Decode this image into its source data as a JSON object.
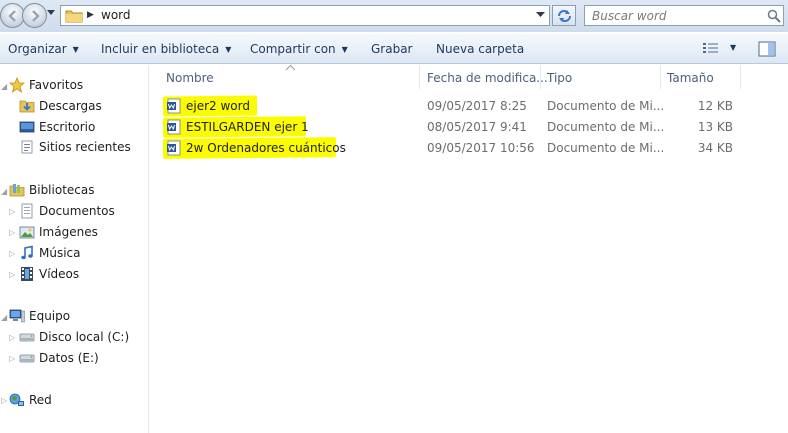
{
  "address": {
    "path": [
      "word"
    ],
    "search_placeholder": "Buscar word"
  },
  "toolbar": {
    "organize": "Organizar",
    "include_library": "Incluir en biblioteca",
    "share_with": "Compartir con",
    "burn": "Grabar",
    "new_folder": "Nueva carpeta"
  },
  "nav": {
    "favorites": {
      "label": "Favoritos",
      "items": [
        "Descargas",
        "Escritorio",
        "Sitios recientes"
      ]
    },
    "libraries": {
      "label": "Bibliotecas",
      "items": [
        "Documentos",
        "Imágenes",
        "Música",
        "Vídeos"
      ]
    },
    "computer": {
      "label": "Equipo",
      "items": [
        "Disco local (C:)",
        "Datos (E:)"
      ]
    },
    "network": {
      "label": "Red"
    }
  },
  "columns": {
    "name": "Nombre",
    "date": "Fecha de modifica...",
    "type": "Tipo",
    "size": "Tamaño"
  },
  "files": [
    {
      "name": "ejer2 word",
      "date": "09/05/2017 8:25",
      "type": "Documento de Mi...",
      "size": "12 KB"
    },
    {
      "name": "ESTILGARDEN ejer 1",
      "date": "08/05/2017 9:41",
      "type": "Documento de Mi...",
      "size": "13 KB"
    },
    {
      "name": "2w Ordenadores cuánticos",
      "date": "09/05/2017 10:56",
      "type": "Documento de Mi...",
      "size": "34 KB"
    }
  ],
  "colors": {
    "highlight": "#fcfc00",
    "command_text": "#1e395b",
    "word_blue": "#2b579a"
  }
}
